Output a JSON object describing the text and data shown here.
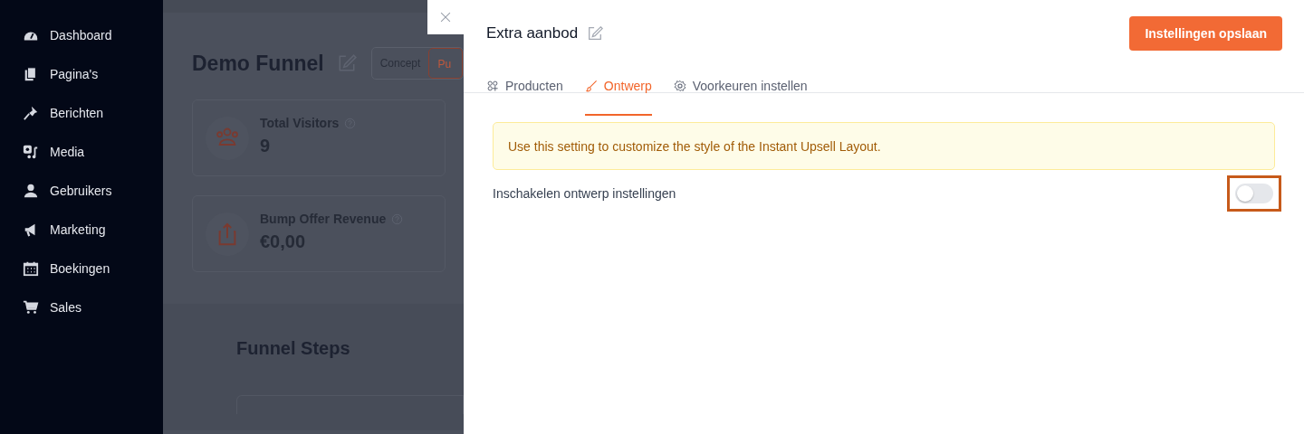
{
  "sidebar": {
    "items": [
      {
        "label": "Dashboard"
      },
      {
        "label": "Pagina's"
      },
      {
        "label": "Berichten"
      },
      {
        "label": "Media"
      },
      {
        "label": "Gebruikers"
      },
      {
        "label": "Marketing"
      },
      {
        "label": "Boekingen"
      },
      {
        "label": "Sales"
      }
    ]
  },
  "backdrop": {
    "title": "Demo Funnel",
    "status": [
      {
        "label": "Concept",
        "selected": false
      },
      {
        "label": "Pu",
        "selected": true
      }
    ],
    "stats": [
      {
        "label": "Total Visitors",
        "value": "9"
      },
      {
        "label": "Bump Offer Revenue",
        "value": "€0,00"
      }
    ],
    "section_title": "Funnel Steps"
  },
  "panel": {
    "title": "Extra aanbod",
    "save_button": "Instellingen opslaan",
    "tabs": [
      {
        "label": "Producten",
        "selected": false
      },
      {
        "label": "Ontwerp",
        "selected": true
      },
      {
        "label": "Voorkeuren instellen",
        "selected": false
      }
    ],
    "notice": "Use this setting to customize the style of the Instant Upsell Layout.",
    "setting": {
      "label": "Inschakelen ontwerp instellingen",
      "on": false,
      "highlighted": true
    }
  }
}
